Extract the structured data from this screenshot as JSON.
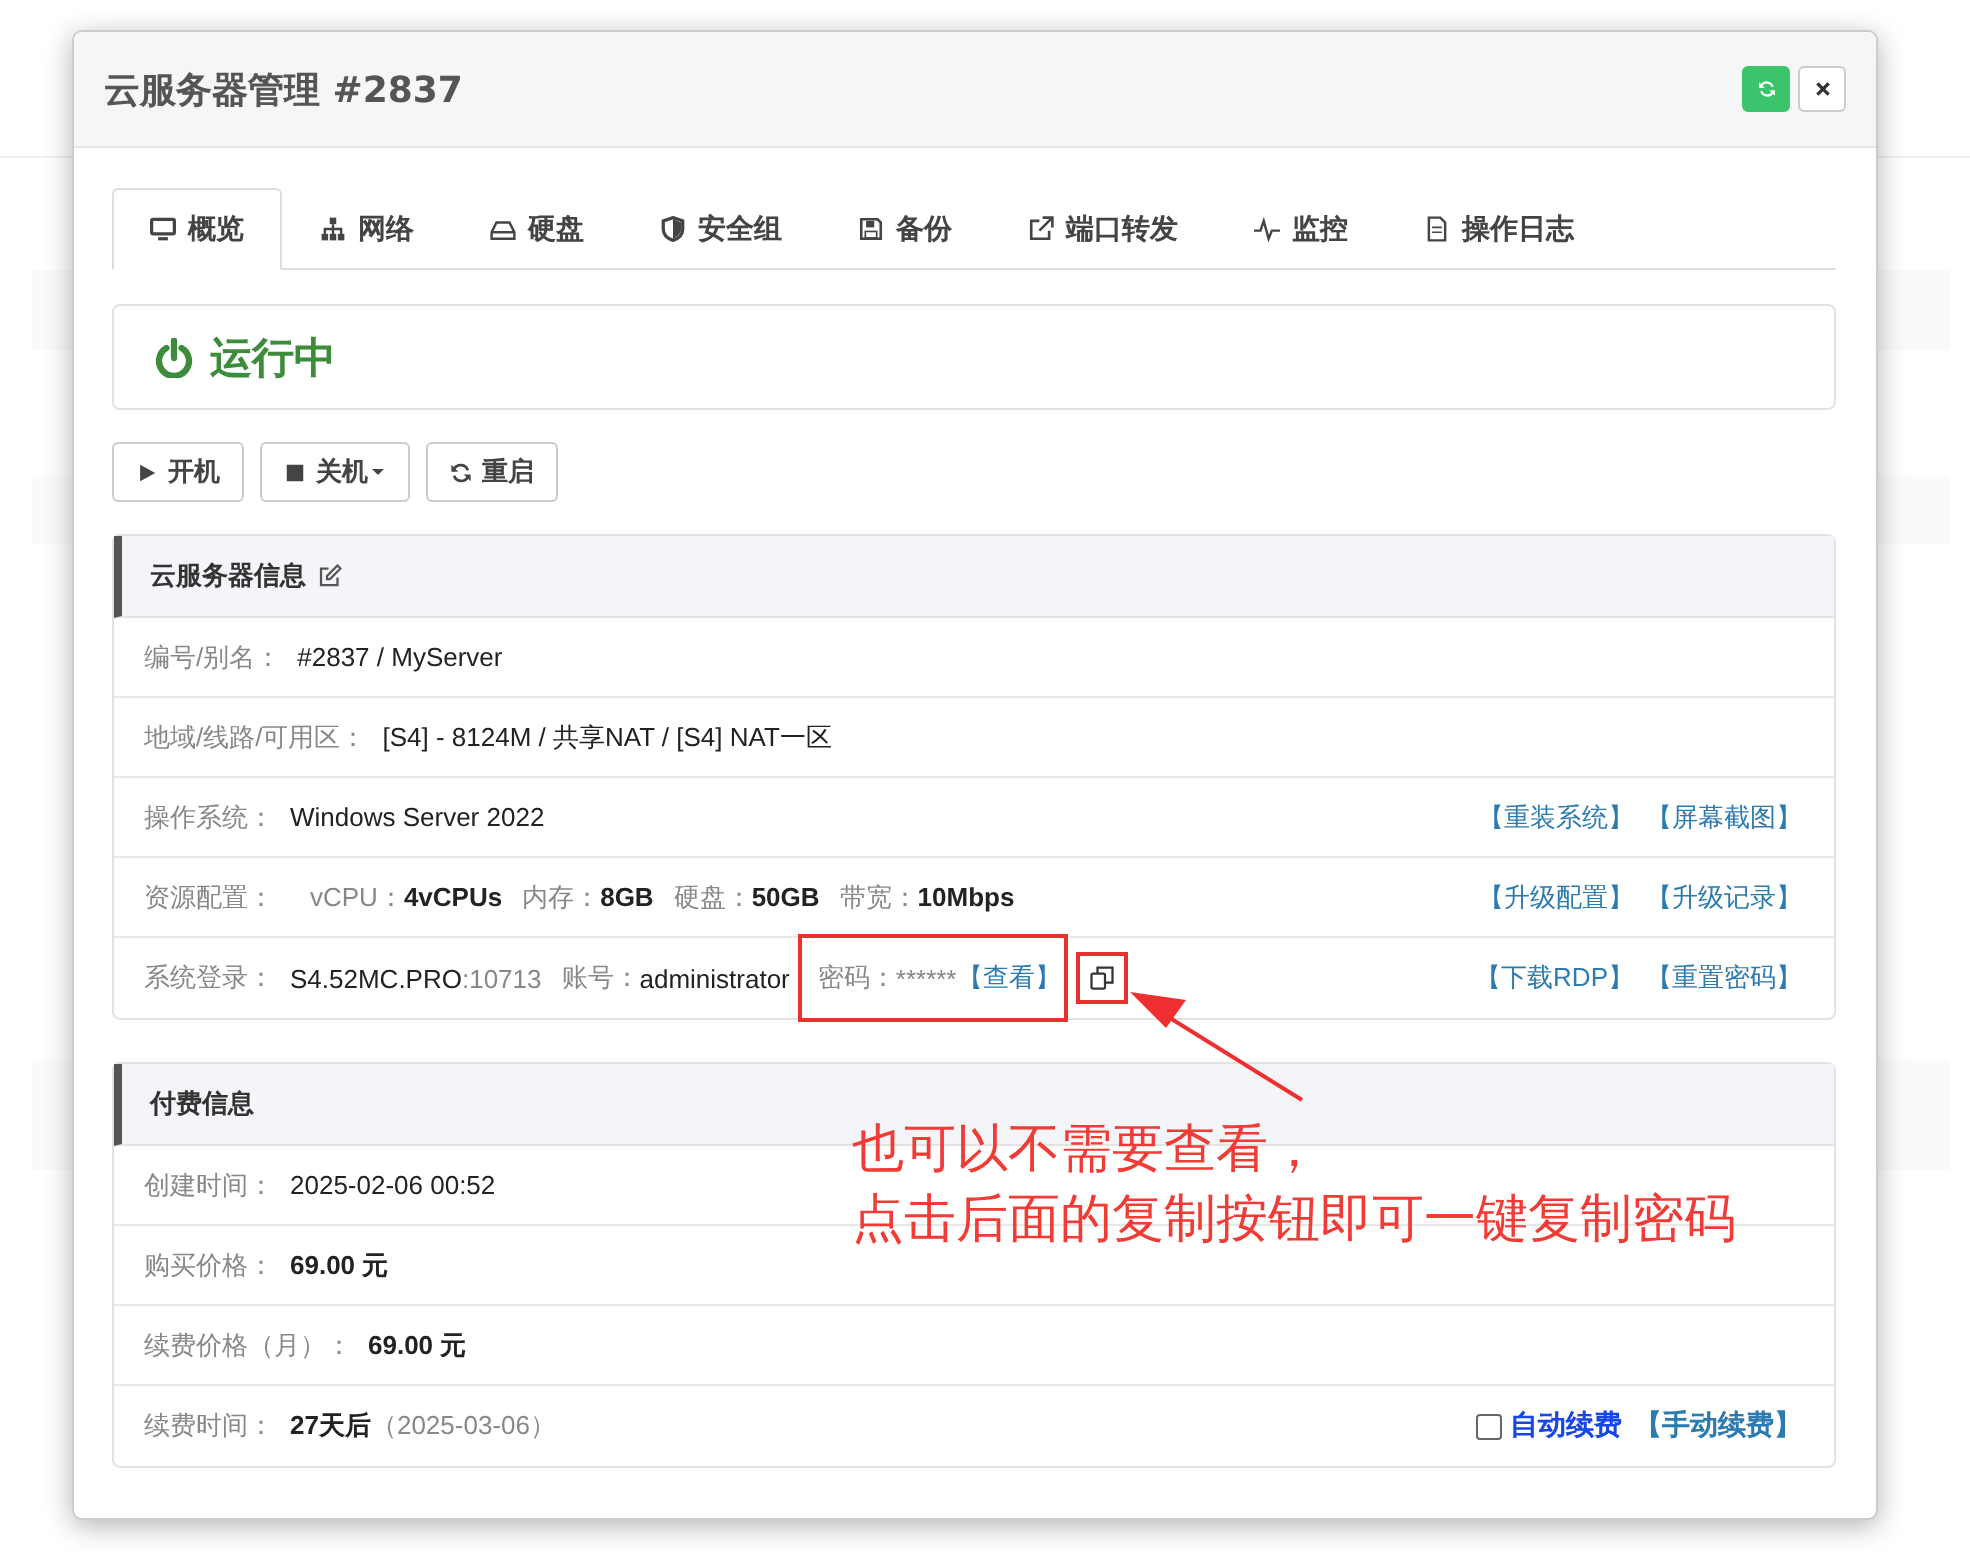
{
  "dialog": {
    "title": "云服务器管理 #2837"
  },
  "tabs": [
    {
      "label": "概览",
      "selected": true
    },
    {
      "label": "网络",
      "selected": false
    },
    {
      "label": "硬盘",
      "selected": false
    },
    {
      "label": "安全组",
      "selected": false
    },
    {
      "label": "备份",
      "selected": false
    },
    {
      "label": "端口转发",
      "selected": false
    },
    {
      "label": "监控",
      "selected": false
    },
    {
      "label": "操作日志",
      "selected": false
    }
  ],
  "status": {
    "label": "运行中",
    "running": true
  },
  "actions": [
    {
      "label": "开机",
      "dropdown": false
    },
    {
      "label": "关机",
      "dropdown": true
    },
    {
      "label": "重启",
      "dropdown": false
    }
  ],
  "info_panel": {
    "title": "云服务器信息",
    "editable": true,
    "rows": [
      {
        "label": "编号/别名：",
        "parts": [
          {
            "kind": "value",
            "text": "#2837 / MyServer"
          }
        ]
      },
      {
        "label": "地域/线路/可用区：",
        "parts": [
          {
            "kind": "value",
            "text": "[S4] - 8124M / 共享NAT / [S4] NAT一区"
          }
        ]
      },
      {
        "label": "操作系统：",
        "parts": [
          {
            "kind": "value",
            "text": "Windows Server 2022"
          }
        ],
        "links": [
          "【重装系统】",
          "【屏幕截图】"
        ]
      },
      {
        "label": "资源配置：",
        "parts": [
          {
            "kind": "label",
            "text": "vCPU："
          },
          {
            "kind": "bold",
            "text": "4vCPUs"
          },
          {
            "kind": "label",
            "text": "内存："
          },
          {
            "kind": "bold",
            "text": "8GB"
          },
          {
            "kind": "label",
            "text": "硬盘："
          },
          {
            "kind": "bold",
            "text": "50GB"
          },
          {
            "kind": "label",
            "text": "带宽："
          },
          {
            "kind": "bold",
            "text": "10Mbps"
          }
        ],
        "links": [
          "【升级配置】",
          "【升级记录】"
        ]
      },
      {
        "label": "系统登录：",
        "parts": [
          {
            "kind": "value",
            "text": "S4.52MC.PRO"
          },
          {
            "kind": "muted",
            "text": ":10713"
          },
          {
            "kind": "label",
            "text": "账号："
          },
          {
            "kind": "value",
            "text": "administrator"
          },
          {
            "kind": "label",
            "text": "密码："
          },
          {
            "kind": "muted",
            "text": "******"
          },
          {
            "kind": "link",
            "text": "【查看】"
          },
          {
            "kind": "copy"
          }
        ],
        "links": [
          "【下载RDP】",
          "【重置密码】"
        ]
      }
    ]
  },
  "billing_panel": {
    "title": "付费信息",
    "rows": [
      {
        "label": "创建时间：",
        "parts": [
          {
            "kind": "value",
            "text": "2025-02-06 00:52"
          }
        ]
      },
      {
        "label": "购买价格：",
        "parts": [
          {
            "kind": "bold",
            "text": "69.00 元"
          }
        ]
      },
      {
        "label": "续费价格（月）：",
        "parts": [
          {
            "kind": "bold",
            "text": "69.00 元"
          }
        ]
      },
      {
        "label": "续费时间：",
        "parts": [
          {
            "kind": "bold",
            "text": "27天后"
          },
          {
            "kind": "muted",
            "text": "（2025-03-06）"
          }
        ],
        "auto_renew": {
          "label": "自动续费",
          "checked": false
        },
        "links": [
          "【手动续费】"
        ]
      }
    ]
  },
  "annotation": {
    "lines": [
      "也可以不需要查看，",
      "点击后面的复制按钮即可一键复制密码"
    ]
  }
}
